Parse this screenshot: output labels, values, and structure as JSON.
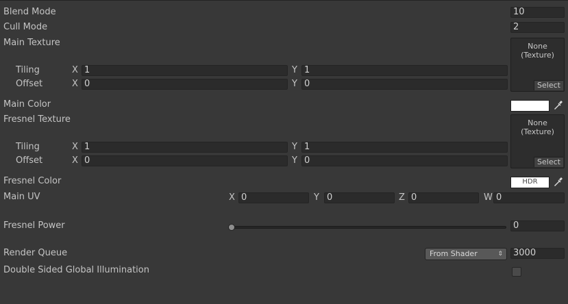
{
  "properties": {
    "blend_mode": {
      "label": "Blend Mode",
      "value": "10"
    },
    "cull_mode": {
      "label": "Cull Mode",
      "value": "2"
    },
    "main_texture": {
      "label": "Main Texture",
      "tiling_label": "Tiling",
      "offset_label": "Offset",
      "tiling_x": "1",
      "tiling_y": "1",
      "offset_x": "0",
      "offset_y": "0",
      "slot_line1": "None",
      "slot_line2": "(Texture)",
      "select_label": "Select"
    },
    "main_color": {
      "label": "Main Color",
      "color": "#ffffff"
    },
    "fresnel_texture": {
      "label": "Fresnel Texture",
      "tiling_label": "Tiling",
      "offset_label": "Offset",
      "tiling_x": "1",
      "tiling_y": "1",
      "offset_x": "0",
      "offset_y": "0",
      "slot_line1": "None",
      "slot_line2": "(Texture)",
      "select_label": "Select"
    },
    "fresnel_color": {
      "label": "Fresnel Color",
      "badge": "HDR",
      "color": "#ffffff"
    },
    "main_uv": {
      "label": "Main UV",
      "x": "0",
      "y": "0",
      "z": "0",
      "w": "0"
    },
    "fresnel_power": {
      "label": "Fresnel Power",
      "value": "0",
      "slider_fraction": 0
    },
    "render_queue": {
      "label": "Render Queue",
      "dropdown": "From Shader",
      "value": "3000"
    },
    "double_sided_gi": {
      "label": "Double Sided Global Illumination",
      "checked": false
    }
  },
  "axes": {
    "x": "X",
    "y": "Y",
    "z": "Z",
    "w": "W"
  },
  "icons": {
    "eyedropper": "eyedropper-icon",
    "dropdown": "dropdown-arrows-icon"
  }
}
